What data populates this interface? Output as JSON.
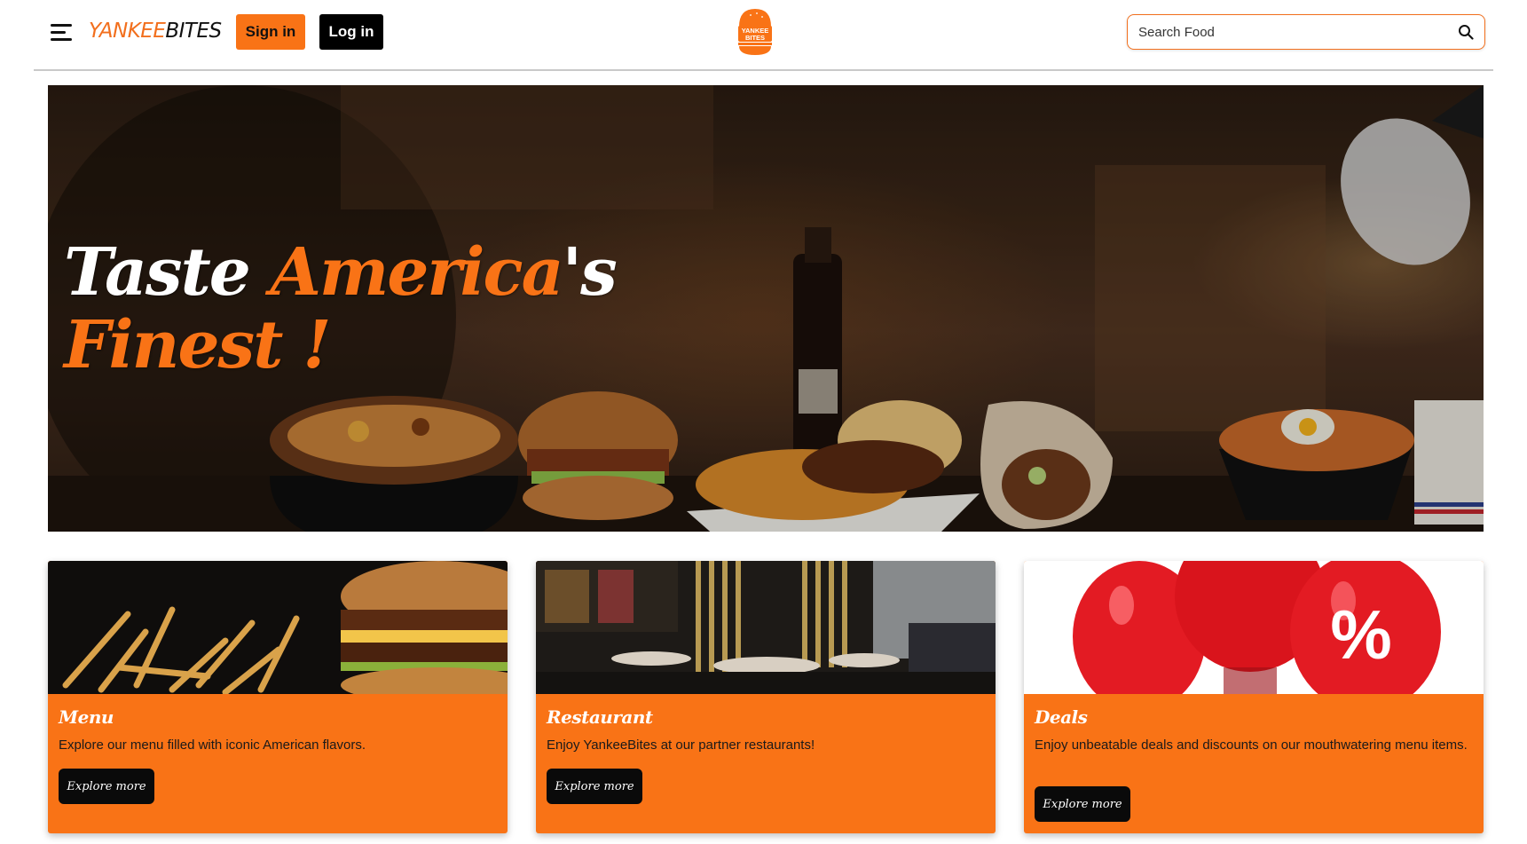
{
  "header": {
    "brand_part1": "YANKEE",
    "brand_part2": "BITES",
    "signin_label": "Sign in",
    "login_label": "Log in",
    "logo_text_top": "YANKEE",
    "logo_text_bottom": "BITES",
    "search_placeholder": "Search Food",
    "search_value": ""
  },
  "hero": {
    "line1_white": "Taste ",
    "line1_orange": "America",
    "line1_suffix": "'s",
    "line2_orange": "Finest",
    "line2_white": " !"
  },
  "cards": [
    {
      "title": "Menu",
      "description": "Explore our menu filled with iconic American flavors.",
      "button": "Explore more"
    },
    {
      "title": "Restaurant",
      "description": "Enjoy YankeeBites at our partner restaurants!",
      "button": "Explore more"
    },
    {
      "title": "Deals",
      "description": "Enjoy unbeatable deals and discounts on our mouthwatering menu items.",
      "button": "Explore more"
    }
  ],
  "colors": {
    "accent": "#f97316",
    "dark": "#000000",
    "background": "#ffffff"
  },
  "icons": [
    "hamburger-menu-icon",
    "burger-logo-icon",
    "search-icon"
  ]
}
